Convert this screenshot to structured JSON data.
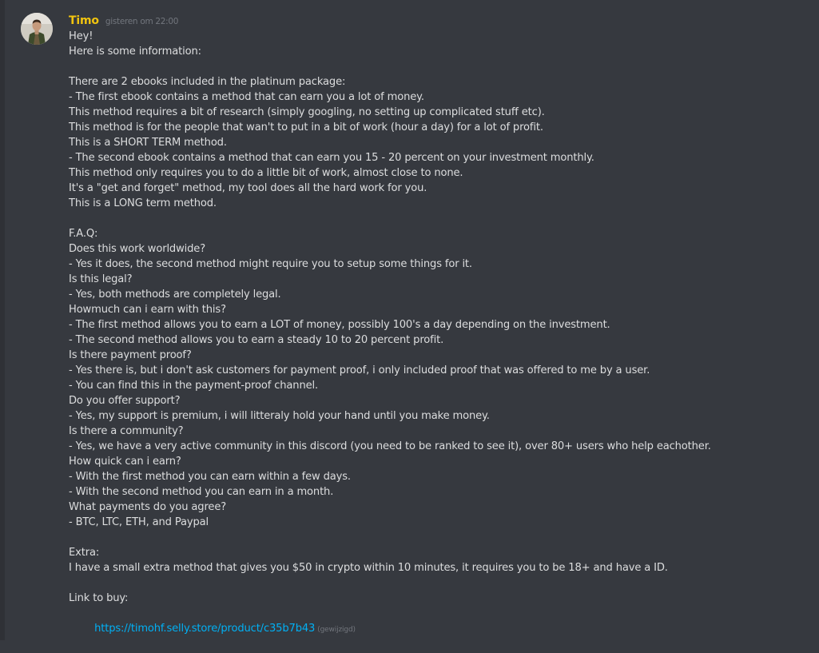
{
  "message": {
    "author": "Timo",
    "timestamp": "gisteren om 22:00",
    "lines": [
      "Hey!",
      "Here is some information:",
      "",
      "There are 2 ebooks included in the platinum package:",
      "- The first ebook contains a method that can earn you a lot of money.",
      "This method requires a bit of research (simply googling, no setting up complicated stuff etc).",
      "This method is for the people that wan't to put in a bit of work (hour a day) for a lot of profit.",
      "This is a SHORT TERM method.",
      "- The second ebook contains a method that can earn you 15 - 20 percent on your investment monthly.",
      "This method only requires you to do a little bit of work, almost close to none.",
      "It's a \"get and forget\" method, my tool does all the hard work for you.",
      "This is a LONG term method.",
      "",
      "F.A.Q:",
      "Does this work worldwide?",
      "- Yes it does, the second method might require you to setup some things for it.",
      "Is this legal?",
      "- Yes, both methods are completely legal.",
      "Howmuch can i earn with this?",
      "- The first method allows you to earn a LOT of money, possibly 100's a day depending on the investment.",
      "- The second method allows you to earn a steady 10 to 20 percent profit.",
      "Is there payment proof?",
      "- Yes there is, but i don't ask customers for payment proof, i only included proof that was offered to me by a user.",
      "- You can find this in the payment-proof channel.",
      "Do you offer support?",
      "- Yes, my support is premium, i will litteraly hold your hand until you make money.",
      "Is there a community?",
      "- Yes, we have a very active community in this discord (you need to be ranked to see it), over 80+ users who help eachother.",
      "How quick can i earn?",
      "- With the first method you can earn within a few days.",
      "- With the second method you can earn in a month.",
      "What payments do you agree?",
      "- BTC, LTC, ETH, and Paypal",
      "",
      "Extra:",
      "I have a small extra method that gives you $50 in crypto within 10 minutes, it requires you to be 18+ and have a ID.",
      "",
      "Link to buy:"
    ],
    "link": "https://timohf.selly.store/product/c35b7b43",
    "edited_label": "(gewijzigd)"
  },
  "colors": {
    "background": "#36393f",
    "username": "#f1c40f",
    "text": "#dcddde",
    "muted": "#72767d",
    "link": "#00b0f4"
  },
  "icons": {
    "avatar": "user-avatar-photo"
  }
}
